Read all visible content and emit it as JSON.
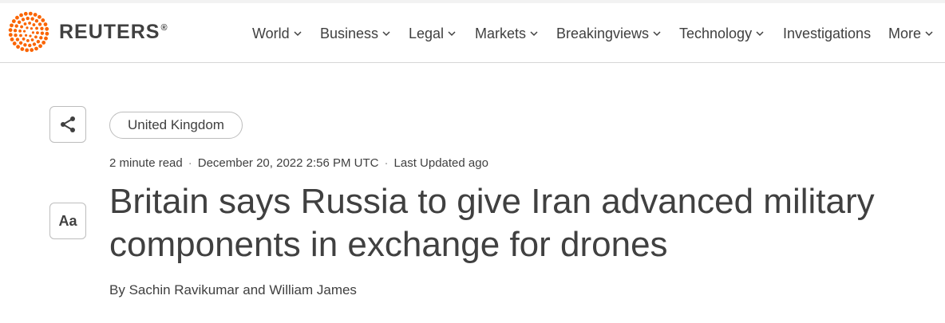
{
  "brand": {
    "name": "REUTERS",
    "registered": "®",
    "accent": "#fa6400"
  },
  "nav": [
    {
      "label": "World",
      "has_menu": true
    },
    {
      "label": "Business",
      "has_menu": true
    },
    {
      "label": "Legal",
      "has_menu": true
    },
    {
      "label": "Markets",
      "has_menu": true
    },
    {
      "label": "Breakingviews",
      "has_menu": true
    },
    {
      "label": "Technology",
      "has_menu": true
    },
    {
      "label": "Investigations",
      "has_menu": false
    },
    {
      "label": "More",
      "has_menu": true
    }
  ],
  "tools": {
    "share_icon": "share-icon",
    "text_size_label": "Aa"
  },
  "article": {
    "tag": "United Kingdom",
    "read_time": "2 minute read",
    "date": "December 20, 2022 2:56 PM UTC",
    "updated": "Last Updated ago",
    "headline_line1": "Britain says Russia to give Iran advanced military",
    "headline_line2": "components in exchange for drones",
    "byline_prefix": "By",
    "author1": "Sachin Ravikumar",
    "byline_and": "and",
    "author2": "William James"
  }
}
